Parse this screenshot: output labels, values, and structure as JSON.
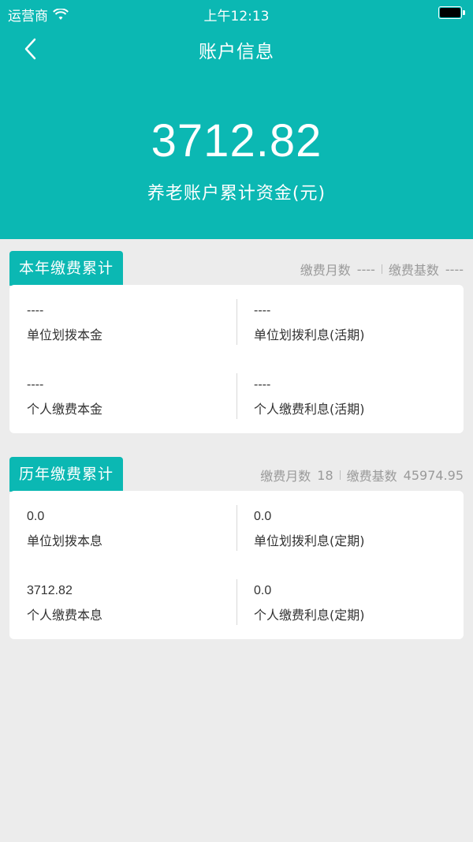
{
  "status_bar": {
    "carrier": "运营商",
    "time": "上午12:13"
  },
  "nav": {
    "title": "账户信息"
  },
  "summary": {
    "balance": "3712.82",
    "label": "养老账户累计资金(元)"
  },
  "sections": [
    {
      "tab": "本年缴费累计",
      "meta": {
        "months_label": "缴费月数",
        "months_value": "----",
        "base_label": "缴费基数",
        "base_value": "----"
      },
      "cells": [
        {
          "value": "----",
          "label": "单位划拨本金"
        },
        {
          "value": "----",
          "label": "单位划拨利息(活期)"
        },
        {
          "value": "----",
          "label": "个人缴费本金"
        },
        {
          "value": "----",
          "label": "个人缴费利息(活期)"
        }
      ]
    },
    {
      "tab": "历年缴费累计",
      "meta": {
        "months_label": "缴费月数",
        "months_value": "18",
        "base_label": "缴费基数",
        "base_value": "45974.95"
      },
      "cells": [
        {
          "value": "0.0",
          "label": "单位划拨本息"
        },
        {
          "value": "0.0",
          "label": "单位划拨利息(定期)"
        },
        {
          "value": "3712.82",
          "label": "个人缴费本息"
        },
        {
          "value": "0.0",
          "label": "个人缴费利息(定期)"
        }
      ]
    }
  ],
  "colors": {
    "primary": "#0bb8b3",
    "background": "#ececec",
    "muted_text": "#9a9a9a"
  }
}
